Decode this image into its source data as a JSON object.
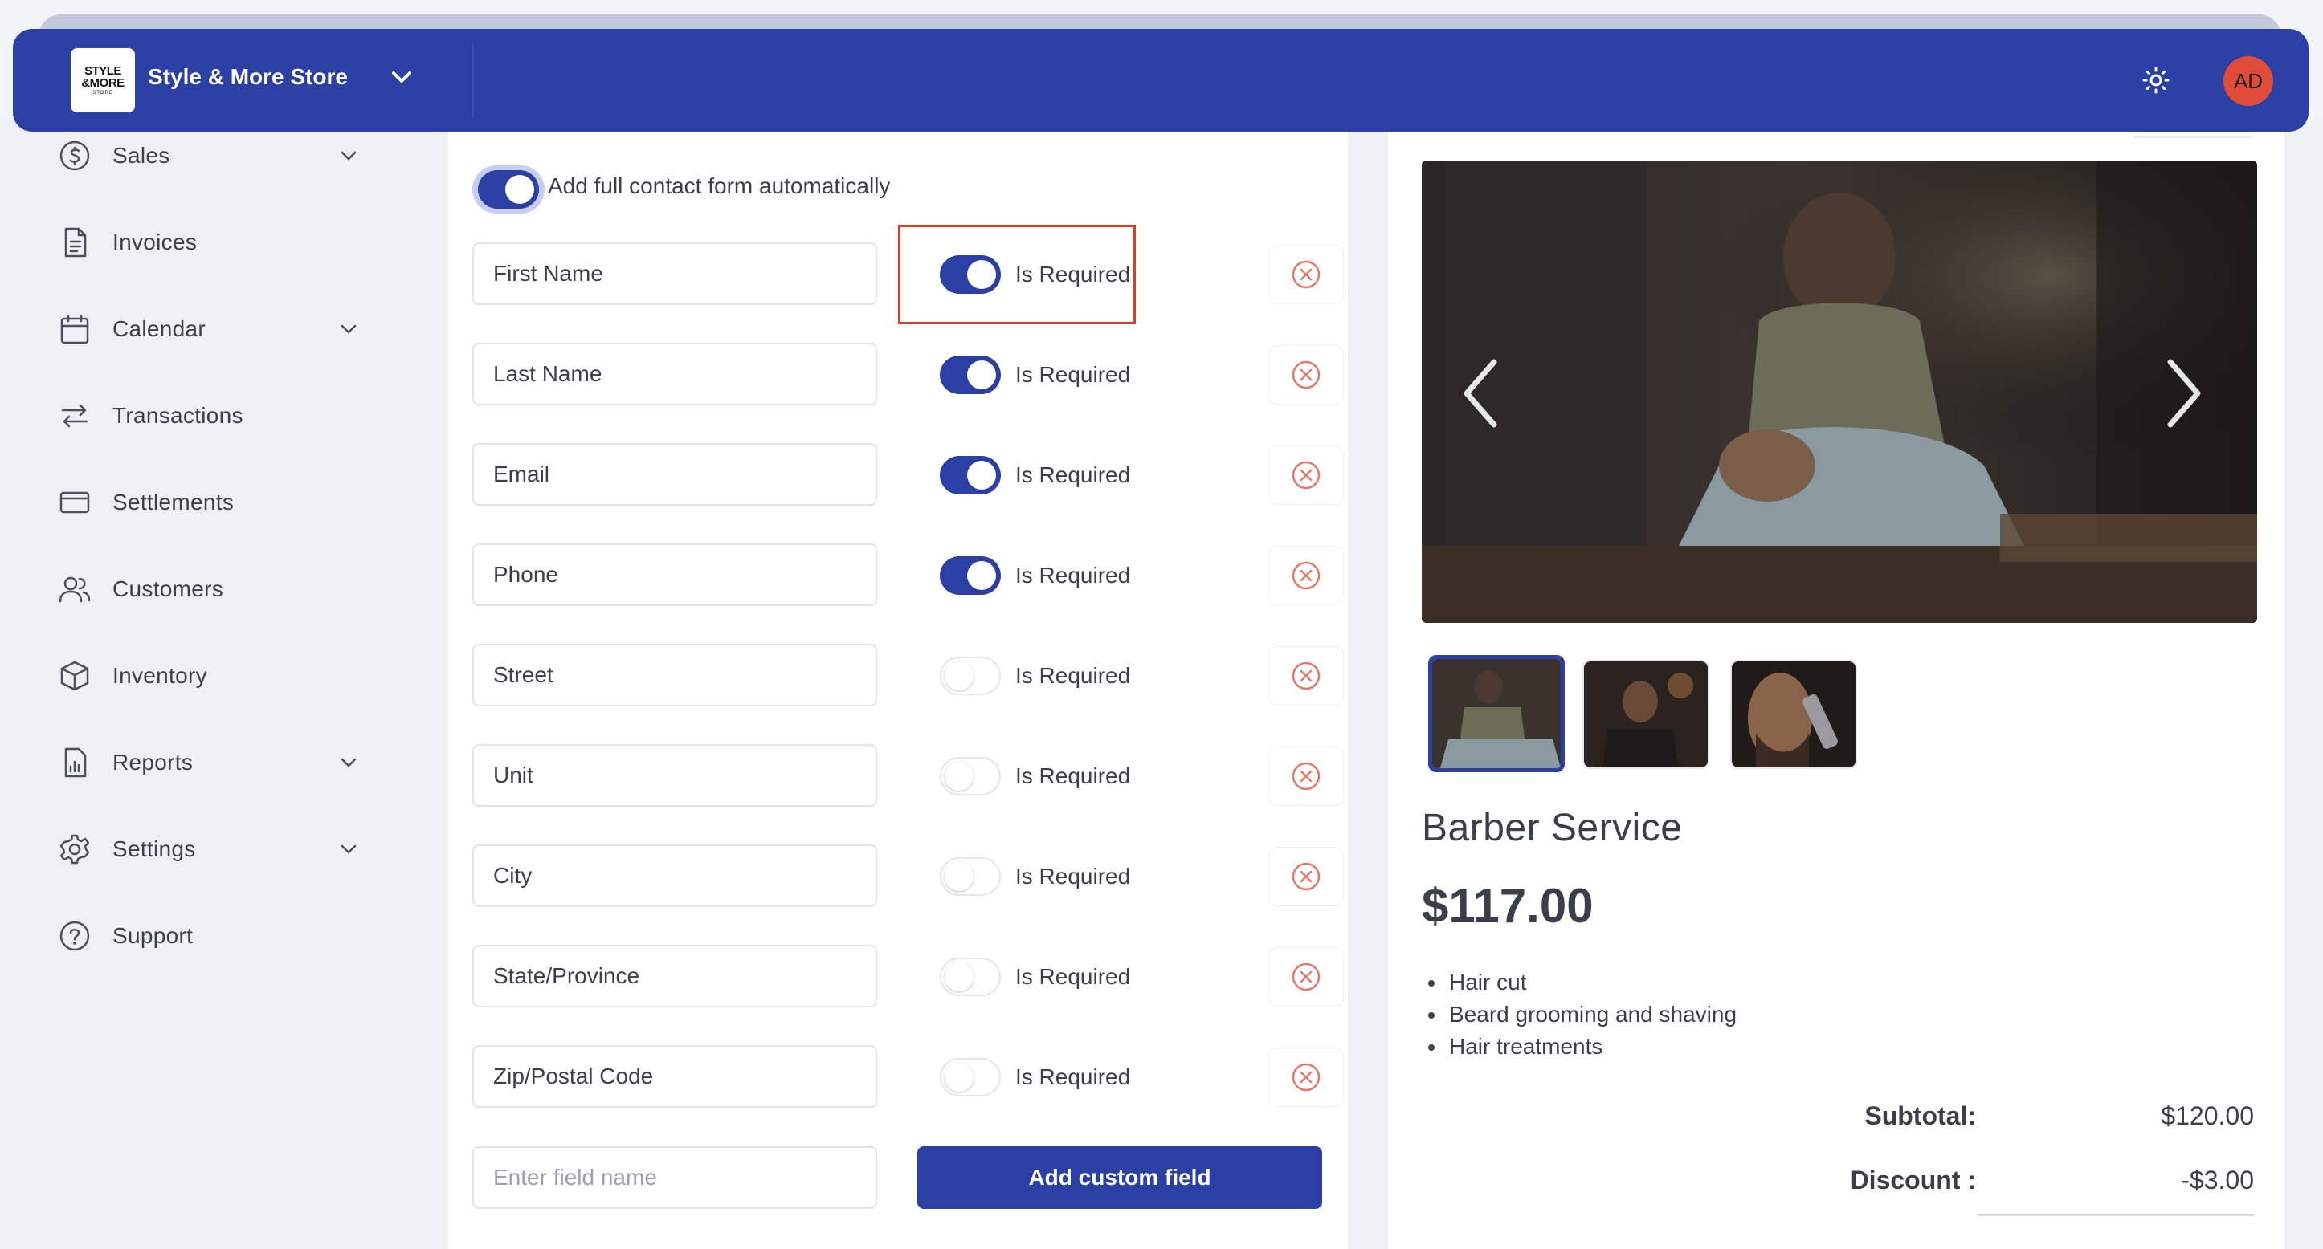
{
  "header": {
    "logo_line1": "STYLE",
    "logo_line2": "&MORE",
    "logo_line3": "STORE",
    "store_name": "Style & More Store",
    "avatar_initials": "AD",
    "theme_icon": "sun-icon",
    "switcher_icon": "chevron-down-icon"
  },
  "sidebar": {
    "items": [
      {
        "label": "Sales",
        "icon": "dollar-circle-icon",
        "has_submenu": true
      },
      {
        "label": "Invoices",
        "icon": "document-icon",
        "has_submenu": false
      },
      {
        "label": "Calendar",
        "icon": "calendar-icon",
        "has_submenu": true
      },
      {
        "label": "Transactions",
        "icon": "arrows-swap-icon",
        "has_submenu": false
      },
      {
        "label": "Settlements",
        "icon": "card-icon",
        "has_submenu": false
      },
      {
        "label": "Customers",
        "icon": "users-icon",
        "has_submenu": false
      },
      {
        "label": "Inventory",
        "icon": "box-icon",
        "has_submenu": false
      },
      {
        "label": "Reports",
        "icon": "report-icon",
        "has_submenu": true
      },
      {
        "label": "Settings",
        "icon": "gear-icon",
        "has_submenu": true
      },
      {
        "label": "Support",
        "icon": "help-circle-icon",
        "has_submenu": false
      }
    ]
  },
  "form": {
    "auto_contact_label": "Add full contact form automatically",
    "auto_contact_enabled": true,
    "required_label": "Is Required",
    "fields": [
      {
        "name": "First Name",
        "required": true
      },
      {
        "name": "Last Name",
        "required": true
      },
      {
        "name": "Email",
        "required": true
      },
      {
        "name": "Phone",
        "required": true
      },
      {
        "name": "Street",
        "required": false
      },
      {
        "name": "Unit",
        "required": false
      },
      {
        "name": "City",
        "required": false
      },
      {
        "name": "State/Province",
        "required": false
      },
      {
        "name": "Zip/Postal Code",
        "required": false
      }
    ],
    "custom_field_placeholder": "Enter field name",
    "add_custom_label": "Add custom field"
  },
  "preview": {
    "title": "Barber Service",
    "price": "$117.00",
    "features": [
      "Hair cut",
      "Beard grooming and shaving",
      "Hair treatments"
    ],
    "subtotal_label": "Subtotal:",
    "subtotal_value": "$120.00",
    "discount_label": "Discount :",
    "discount_value": "-$3.00"
  },
  "colors": {
    "primary": "#2b3fa5",
    "avatar": "#e04b3a",
    "remove_icon": "#e8786a",
    "highlight": "#e03c2a"
  }
}
